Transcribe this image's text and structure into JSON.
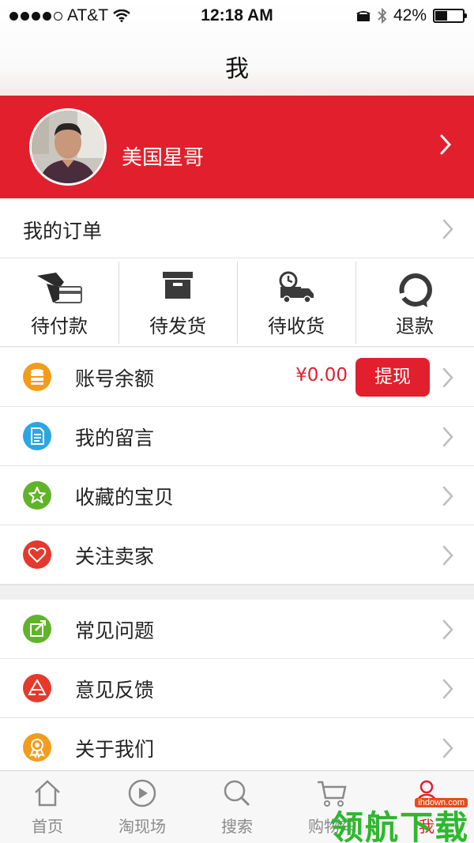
{
  "status_bar": {
    "carrier": "AT&T",
    "time": "12:18 AM",
    "battery": "42%",
    "battery_level": 0.42,
    "signal_bars": 4
  },
  "nav": {
    "title": "我"
  },
  "profile": {
    "username": "美国星哥"
  },
  "orders": {
    "title": "我的订单",
    "items": [
      {
        "label": "待付款",
        "icon": "card-payment-icon"
      },
      {
        "label": "待发货",
        "icon": "box-icon"
      },
      {
        "label": "待收货",
        "icon": "delivery-truck-icon"
      },
      {
        "label": "退款",
        "icon": "refund-icon"
      }
    ]
  },
  "menu1": [
    {
      "label": "账号余额",
      "icon": "coins-icon",
      "color": "#f39c1a"
    },
    {
      "label": "我的留言",
      "icon": "document-icon",
      "color": "#2ba6e1"
    },
    {
      "label": "收藏的宝贝",
      "icon": "star-icon",
      "color": "#61b32a"
    },
    {
      "label": "关注卖家",
      "icon": "heart-icon",
      "color": "#e5392d"
    }
  ],
  "balance": {
    "amount": "¥0.00",
    "button": "提现"
  },
  "menu2": [
    {
      "label": "常见问题",
      "icon": "edit-icon",
      "color": "#61b32a"
    },
    {
      "label": "意见反馈",
      "icon": "recycle-icon",
      "color": "#e5392d"
    },
    {
      "label": "关于我们",
      "icon": "badge-icon",
      "color": "#f39c1a"
    }
  ],
  "tabs": [
    {
      "label": "首页",
      "icon": "home-icon"
    },
    {
      "label": "淘现场",
      "icon": "play-icon"
    },
    {
      "label": "搜索",
      "icon": "search-icon"
    },
    {
      "label": "购物车",
      "icon": "cart-icon"
    },
    {
      "label": "我",
      "icon": "user-icon",
      "active": true
    }
  ],
  "watermark": {
    "text": "领航下载",
    "url": "ihdown.com"
  },
  "colors": {
    "accent": "#e11f2d",
    "tab_inactive": "#8a8a8a"
  }
}
